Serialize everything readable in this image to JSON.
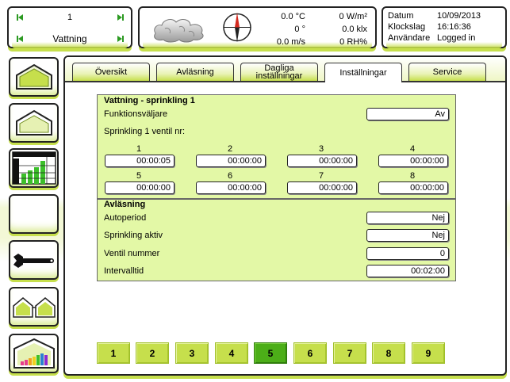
{
  "nav": {
    "index": "1",
    "label": "Vattning"
  },
  "weather": {
    "temperature": "0.0 °C",
    "wind_direction": "0 °",
    "wind_speed": "0.0 m/s",
    "radiation": "0 W/m²",
    "light": "0.0 klx",
    "humidity": "0 RH%"
  },
  "info": {
    "date_label": "Datum",
    "date_value": "10/09/2013",
    "time_label": "Klockslag",
    "time_value": "16:16:36",
    "user_label": "Användare",
    "user_value": "Logged in"
  },
  "sidebar": [
    {
      "icon": "greenhouse-icon"
    },
    {
      "icon": "greenhouse-outline-icon"
    },
    {
      "icon": "chart-table-icon"
    },
    {
      "icon": "blank-icon"
    },
    {
      "icon": "wrench-icon"
    },
    {
      "icon": "greenhouse-row-icon"
    },
    {
      "icon": "greenhouse-chart-icon"
    }
  ],
  "tabs": [
    {
      "label": "Översikt"
    },
    {
      "label": "Avläsning"
    },
    {
      "label": "Dagliga inställningar"
    },
    {
      "label": "Inställningar",
      "active": true
    },
    {
      "label": "Service"
    }
  ],
  "section1": {
    "title": "Vattning - sprinkling 1",
    "selector_label": "Funktionsväljare",
    "selector_value": "Av",
    "valve_heading": "Sprinkling 1 ventil nr:",
    "valves": [
      {
        "num": "1",
        "value": "00:00:05"
      },
      {
        "num": "2",
        "value": "00:00:00"
      },
      {
        "num": "3",
        "value": "00:00:00"
      },
      {
        "num": "4",
        "value": "00:00:00"
      },
      {
        "num": "5",
        "value": "00:00:00"
      },
      {
        "num": "6",
        "value": "00:00:00"
      },
      {
        "num": "7",
        "value": "00:00:00"
      },
      {
        "num": "8",
        "value": "00:00:00"
      }
    ]
  },
  "section2": {
    "title": "Avläsning",
    "rows": [
      {
        "label": "Autoperiod",
        "value": "Nej"
      },
      {
        "label": "Sprinkling aktiv",
        "value": "Nej"
      },
      {
        "label": "Ventil nummer",
        "value": "0"
      },
      {
        "label": "Intervalltid",
        "value": "00:02:00"
      }
    ]
  },
  "pages": [
    {
      "label": "1"
    },
    {
      "label": "2"
    },
    {
      "label": "3"
    },
    {
      "label": "4"
    },
    {
      "label": "5",
      "active": true
    },
    {
      "label": "6"
    },
    {
      "label": "7"
    },
    {
      "label": "8"
    },
    {
      "label": "9"
    }
  ],
  "colors": {
    "accent": "#c6df4c",
    "active_page": "#4cae18",
    "section_bg": "#e3f8a6",
    "arrow_green": "#2c9a22"
  }
}
